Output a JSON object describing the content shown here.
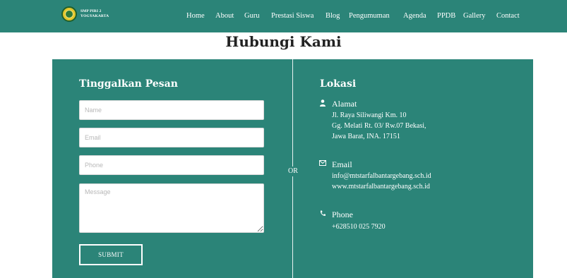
{
  "nav": {
    "logo_line1": "SMP PIRI 2",
    "logo_line2": "YOGYAKARTA",
    "items": [
      "Home",
      "About",
      "Guru",
      "Prestasi Siswa",
      "Blog",
      "Pengumuman",
      "Agenda",
      "PPDB",
      "Gallery",
      "Contact"
    ]
  },
  "page": {
    "title": "Hubungi Kami"
  },
  "form": {
    "heading": "Tinggalkan Pesan",
    "name_placeholder": "Name",
    "email_placeholder": "Email",
    "phone_placeholder": "Phone",
    "message_placeholder": "Message",
    "submit_label": "SUBMIT"
  },
  "divider": {
    "label": "OR"
  },
  "location": {
    "heading": "Lokasi",
    "address": {
      "title": "Alamat",
      "icon": "person-icon",
      "lines": [
        "Jl. Raya Siliwangi Km. 10",
        "Gg. Melati Rt. 03/ Rw.07 Bekasi,",
        "Jawa Barat, INA. 17151"
      ]
    },
    "email": {
      "title": "Email",
      "icon": "envelope-icon",
      "lines": [
        "info@mtstarfalbantargebang.sch.id",
        "www.mtstarfalbantargebang.sch.id"
      ]
    },
    "phone": {
      "title": "Phone",
      "icon": "phone-icon",
      "lines": [
        "+628510 025 7920"
      ]
    }
  },
  "colors": {
    "teal": "#2b8478",
    "white": "#ffffff",
    "title_text": "#222222",
    "logo_gold": "#e3c72c"
  }
}
